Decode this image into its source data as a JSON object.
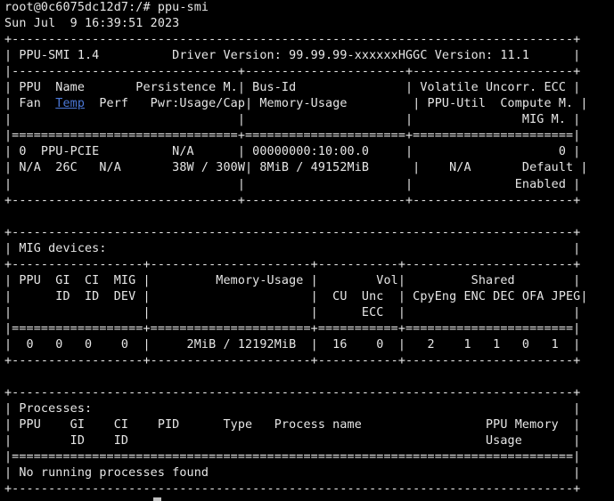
{
  "terminal": {
    "prompt_line": "root@0c6075dc12d7:/# ppu-smi",
    "date_line": "Sun Jul  9 16:39:51 2023",
    "link_color": "#4b78d8",
    "lines": [
      "+-----------------------------------------------------------------------------+",
      "| PPU-SMI 1.4          Driver Version: 99.99.99-xxxxxxHGGC Version: 11.1      |",
      "|-------------------------------+----------------------+----------------------+",
      "| PPU  Name       Persistence M.| Bus-Id               | Volatile Uncorr. ECC |",
      "| Fan  {Temp}  Perf   Pwr:Usage/Cap| Memory-Usage         | PPU-Util  Compute M. |",
      "|                               |                      |               MIG M. |",
      "|===============================+======================+======================|",
      "| 0  PPU-PCIE          N/A      | 00000000:10:00.0     |                    0 |",
      "| N/A  26C   N/A       38W / 300W| 8MiB / 49152MiB      |    N/A       Default |",
      "|                               |                      |              Enabled |",
      "+-------------------------------+----------------------+----------------------+",
      "",
      "+-----------------------------------------------------------------------------+",
      "| MIG devices:                                                                |",
      "+------------------+----------------------+-----------+-----------------------+",
      "| PPU  GI  CI  MIG |         Memory-Usage |        Vol|         Shared        |",
      "|      ID  ID  DEV |                      |  CU  Unc  | CpyEng ENC DEC OFA JPEG|",
      "|                  |                      |      ECC  |                       |",
      "|==================+======================+===========+=======================|",
      "|  0   0   0    0  |     2MiB / 12192MiB  |  16    0  |   2    1   1   0   1  |",
      "+------------------+----------------------+-----------+-----------------------+",
      "",
      "+-----------------------------------------------------------------------------+",
      "| Processes:                                                                  |",
      "| PPU    GI    CI    PID      Type   Process name                 PPU Memory  |",
      "|        ID    ID                                                 Usage       |",
      "|=============================================================================|",
      "| No running processes found                                                  |",
      "+-----------------------------------------------------------------------------+"
    ]
  }
}
